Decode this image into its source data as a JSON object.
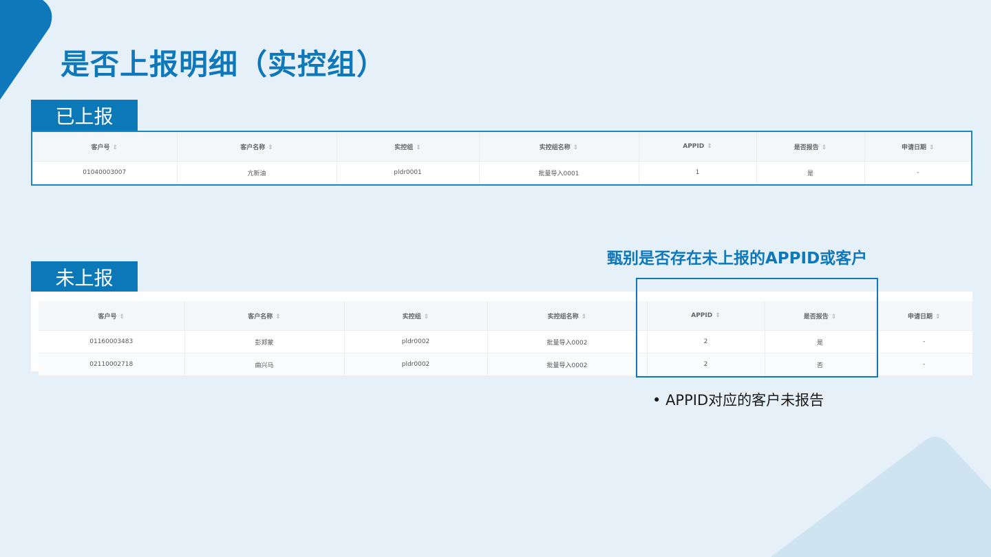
{
  "colors": {
    "primary": "#0e78ba",
    "tab_bg": "#0b78b8",
    "background": "#e5f0f8"
  },
  "title": "是否上报明细（实控组）",
  "icons": {
    "sort": "sort-icon"
  },
  "sections": {
    "reported": {
      "label": "已上报",
      "headers": [
        "客户号",
        "客户名称",
        "实控组",
        "实控组名称",
        "APPID",
        "是否报告",
        "申请日期"
      ],
      "rows": [
        [
          "01040003007",
          "亢新油",
          "pldr0001",
          "批量导入0001",
          "1",
          "是",
          "-"
        ]
      ]
    },
    "unreported": {
      "label": "未上报",
      "headers": [
        "客户号",
        "客户名称",
        "实控组",
        "实控组名称",
        "APPID",
        "是否报告",
        "申请日期"
      ],
      "rows": [
        [
          "01160003483",
          "彭郑蒙",
          "pldr0002",
          "批量导入0002",
          "2",
          "是",
          "-"
        ],
        [
          "02110002718",
          "曲兴马",
          "pldr0002",
          "批量导入0002",
          "2",
          "否",
          "-"
        ]
      ]
    }
  },
  "annotation": "甄别是否存在未上报的APPID或客户",
  "bullet_note": "APPID对应的客户未报告"
}
